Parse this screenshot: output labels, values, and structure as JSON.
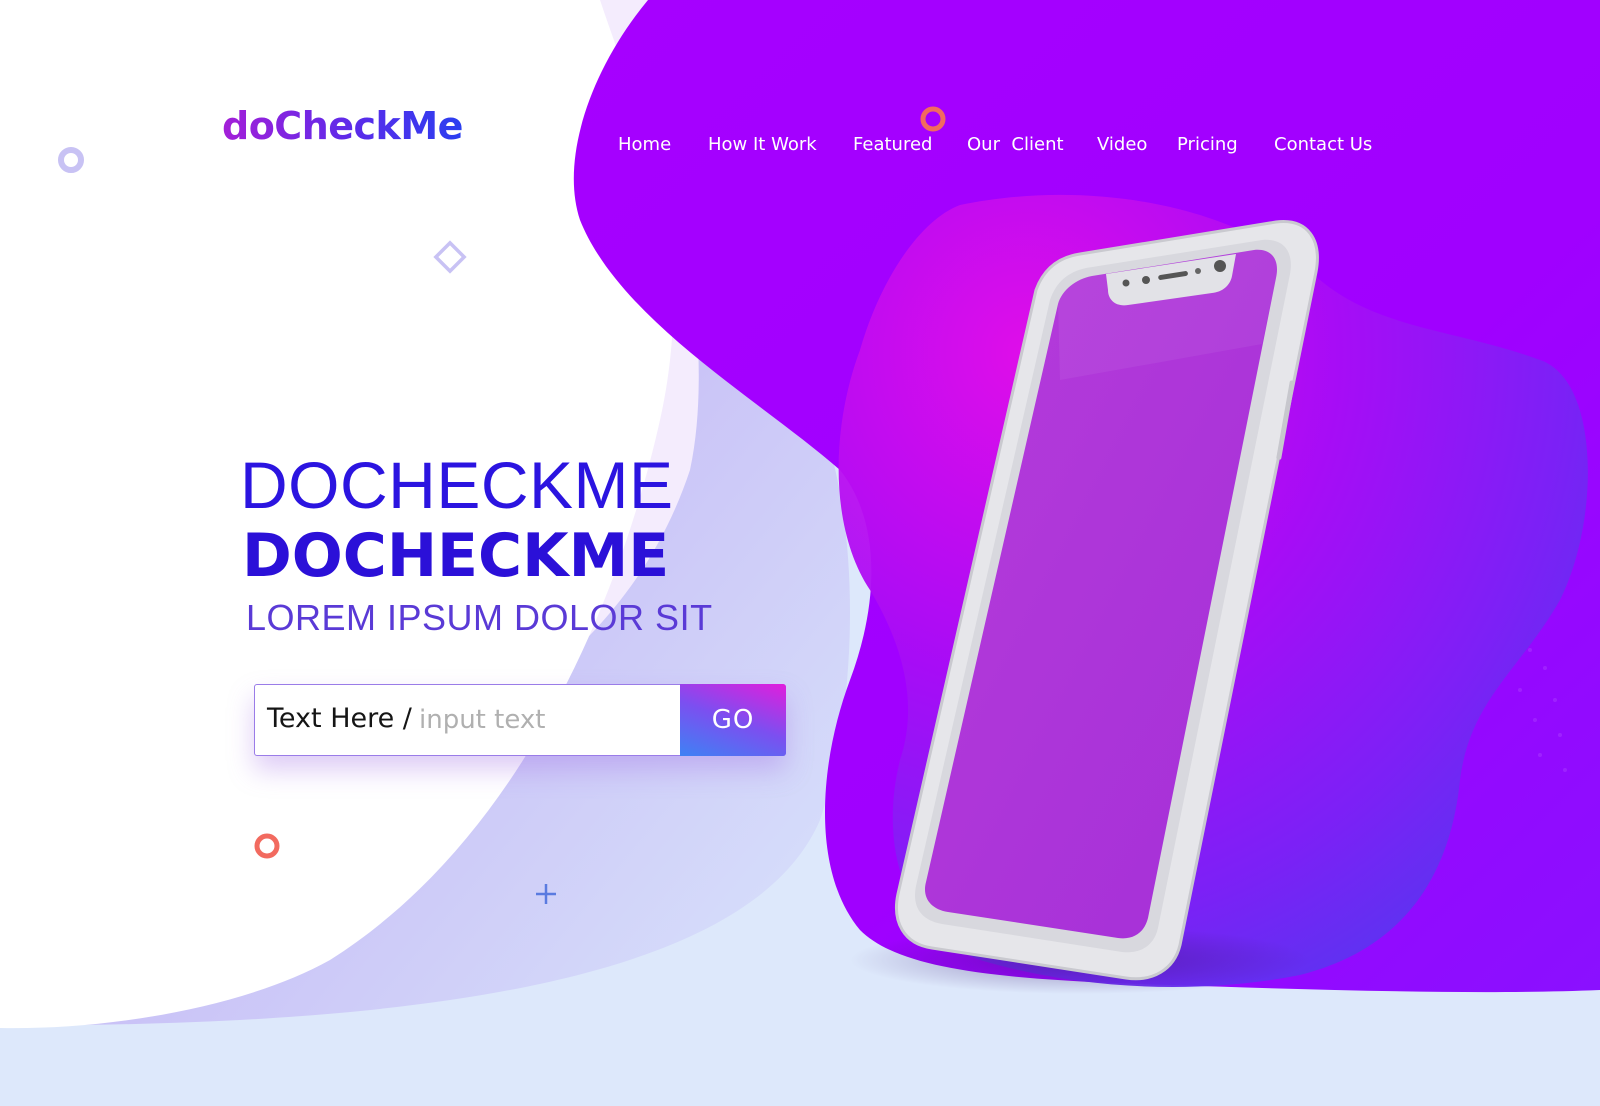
{
  "brand": {
    "logo_text": "doCheckMe"
  },
  "nav": {
    "items": [
      {
        "label": "Home"
      },
      {
        "label": "How It Work"
      },
      {
        "label": "Featured"
      },
      {
        "label": "Our  Client"
      },
      {
        "label": "Video"
      },
      {
        "label": "Pricing"
      },
      {
        "label": "Contact Us"
      }
    ]
  },
  "hero": {
    "line1": "DOCHECKME",
    "line2": "DOCHECKME",
    "subtitle": "LOREM IPSUM DOLOR SIT"
  },
  "search": {
    "label": "Text Here /",
    "placeholder": "input text",
    "value": "",
    "button_label": "GO"
  },
  "colors": {
    "accent_purple": "#a400ff",
    "headline_blue": "#2b14e0",
    "coral": "#f26a5f",
    "background_light": "#dde8fb"
  },
  "icons": [
    "ring-icon",
    "diamond-icon",
    "plus-icon",
    "phone-mockup"
  ]
}
